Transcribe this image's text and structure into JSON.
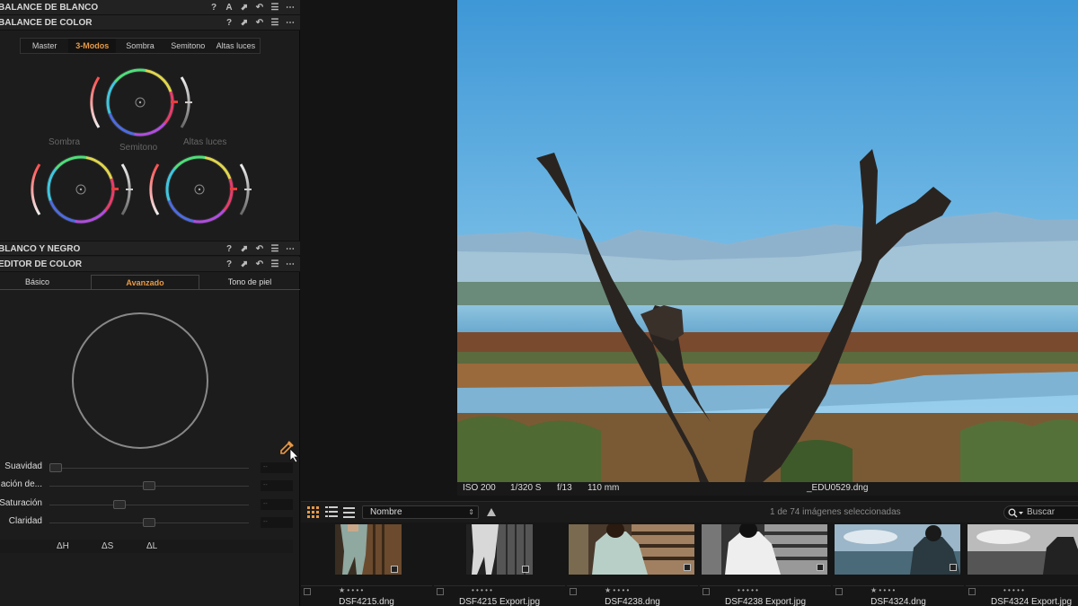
{
  "sections": {
    "white_balance": "BALANCE DE BLANCO",
    "color_balance": "BALANCE DE COLOR",
    "black_white": "BLANCO Y NEGRO",
    "color_editor": "EDITOR DE COLOR"
  },
  "header_icons": {
    "help": "?",
    "auto": "A",
    "copy": "⬈",
    "reset": "↶",
    "menu": "☰",
    "more": "⋯"
  },
  "color_balance": {
    "tabs": [
      "Master",
      "3-Modos",
      "Sombra",
      "Semitono",
      "Altas luces"
    ],
    "active_tab": "3-Modos",
    "wheels": {
      "shadow": "Sombra",
      "midtone": "Semitono",
      "highlights": "Altas luces"
    }
  },
  "color_editor": {
    "tabs": [
      "Básico",
      "Avanzado",
      "Tono de piel"
    ],
    "active_tab": "Avanzado",
    "sliders": [
      {
        "label": "Suavidad",
        "value": "--",
        "level": 0.03
      },
      {
        "label": "ación de...",
        "value": "--",
        "level": 0.5
      },
      {
        "label": "Saturación",
        "value": "--",
        "level": 0.35
      },
      {
        "label": "Claridad",
        "value": "--",
        "level": 0.5
      }
    ],
    "deltas": [
      "ΔH",
      "ΔS",
      "ΔL"
    ]
  },
  "viewer": {
    "iso": "ISO 200",
    "shutter": "1/320 S",
    "aperture": "f/13",
    "focal": "110 mm",
    "filename": "_EDU0529.dng"
  },
  "browser": {
    "sort_value": "Nombre",
    "selection_status": "1 de 74 imágenes seleccionadas",
    "search_placeholder": "Buscar",
    "thumbnails": [
      {
        "name": "DSF4215.dng",
        "rating": "★ • • • •"
      },
      {
        "name": "DSF4215 Export.jpg",
        "rating": "• • • • •"
      },
      {
        "name": "DSF4238.dng",
        "rating": "★ • • • •"
      },
      {
        "name": "DSF4238 Export.jpg",
        "rating": "• • • • •"
      },
      {
        "name": "DSF4324.dng",
        "rating": "★ • • • •"
      },
      {
        "name": "DSF4324 Export.jpg",
        "rating": "• • • • •"
      }
    ]
  },
  "colors": {
    "accent": "#e89a45",
    "panel": "#1c1c1c",
    "sky": "#5aa8dc"
  }
}
